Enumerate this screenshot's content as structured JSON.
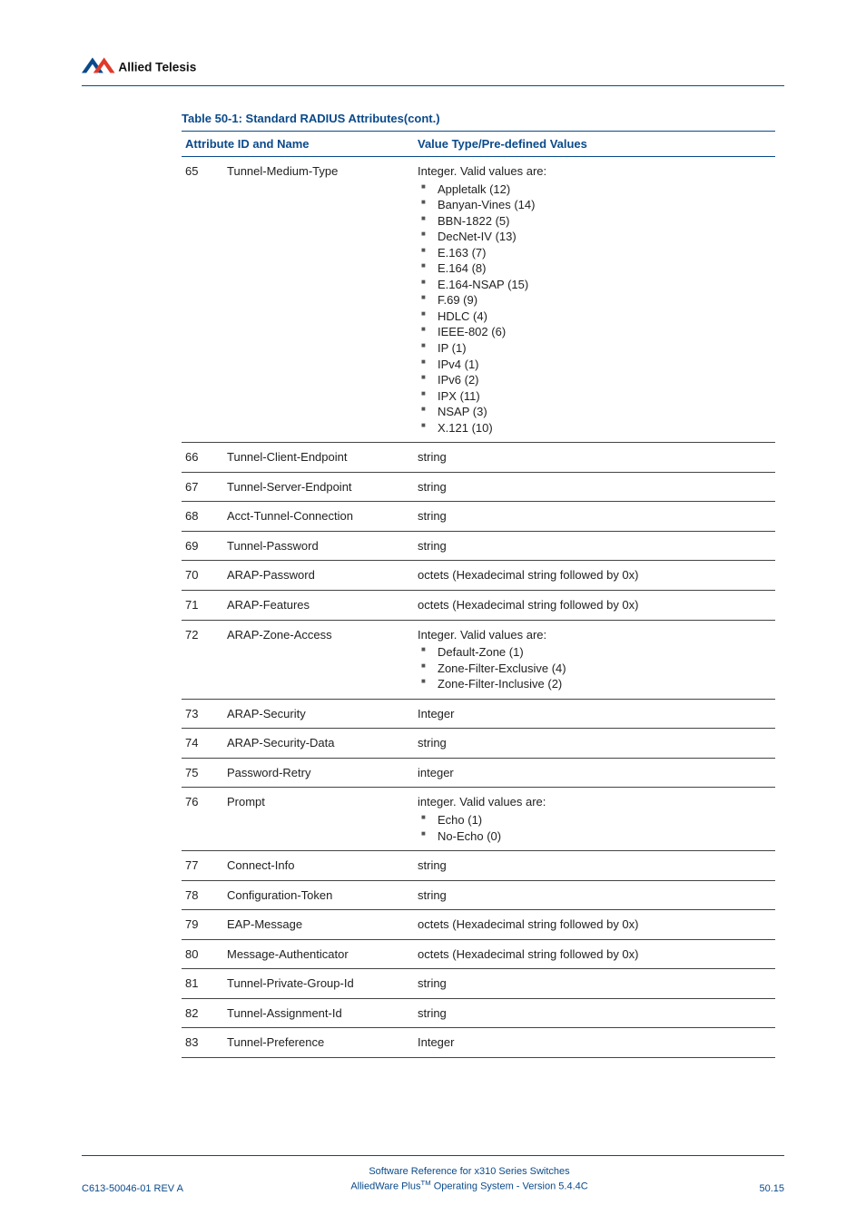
{
  "logo": {
    "brand_text": "Allied Telesis"
  },
  "table": {
    "title": "Table 50-1: Standard RADIUS Attributes(cont.)",
    "head": {
      "col_idname": "Attribute ID and Name",
      "col_value": "Value Type/Pre-defined Values"
    },
    "rows": [
      {
        "id": "65",
        "name": "Tunnel-Medium-Type",
        "value_lead": "Integer. Valid values are:",
        "value_list": [
          "Appletalk (12)",
          "Banyan-Vines (14)",
          "BBN-1822 (5)",
          "DecNet-IV (13)",
          "E.163 (7)",
          "E.164 (8)",
          "E.164-NSAP (15)",
          "F.69 (9)",
          "HDLC (4)",
          "IEEE-802 (6)",
          "IP (1)",
          "IPv4 (1)",
          "IPv6 (2)",
          "IPX (11)",
          "NSAP (3)",
          "X.121 (10)"
        ]
      },
      {
        "id": "66",
        "name": "Tunnel-Client-Endpoint",
        "value_text": "string"
      },
      {
        "id": "67",
        "name": "Tunnel-Server-Endpoint",
        "value_text": "string"
      },
      {
        "id": "68",
        "name": "Acct-Tunnel-Connection",
        "value_text": "string"
      },
      {
        "id": "69",
        "name": "Tunnel-Password",
        "value_text": "string"
      },
      {
        "id": "70",
        "name": "ARAP-Password",
        "value_text": "octets (Hexadecimal string followed by 0x)"
      },
      {
        "id": "71",
        "name": "ARAP-Features",
        "value_text": "octets (Hexadecimal string followed by 0x)"
      },
      {
        "id": "72",
        "name": "ARAP-Zone-Access",
        "value_lead": "Integer. Valid values are:",
        "value_list": [
          "Default-Zone (1)",
          "Zone-Filter-Exclusive (4)",
          "Zone-Filter-Inclusive (2)"
        ]
      },
      {
        "id": "73",
        "name": "ARAP-Security",
        "value_text": "Integer"
      },
      {
        "id": "74",
        "name": "ARAP-Security-Data",
        "value_text": "string"
      },
      {
        "id": "75",
        "name": "Password-Retry",
        "value_text": "integer"
      },
      {
        "id": "76",
        "name": "Prompt",
        "value_lead": "integer. Valid values are:",
        "value_list": [
          "Echo (1)",
          "No-Echo (0)"
        ]
      },
      {
        "id": "77",
        "name": "Connect-Info",
        "value_text": "string"
      },
      {
        "id": "78",
        "name": "Configuration-Token",
        "value_text": "string"
      },
      {
        "id": "79",
        "name": "EAP-Message",
        "value_text": "octets (Hexadecimal string followed by 0x)"
      },
      {
        "id": "80",
        "name": "Message-Authenticator",
        "value_text": "octets (Hexadecimal string followed by 0x)"
      },
      {
        "id": "81",
        "name": "Tunnel-Private-Group-Id",
        "value_text": "string"
      },
      {
        "id": "82",
        "name": "Tunnel-Assignment-Id",
        "value_text": "string"
      },
      {
        "id": "83",
        "name": "Tunnel-Preference",
        "value_text": "Integer"
      }
    ]
  },
  "footer": {
    "left": "C613-50046-01 REV A",
    "center_line1": "Software Reference for x310 Series Switches",
    "center_line2_pre": "AlliedWare Plus",
    "center_line2_sup": "TM",
    "center_line2_post": " Operating System - Version 5.4.4C",
    "right": "50.15"
  }
}
